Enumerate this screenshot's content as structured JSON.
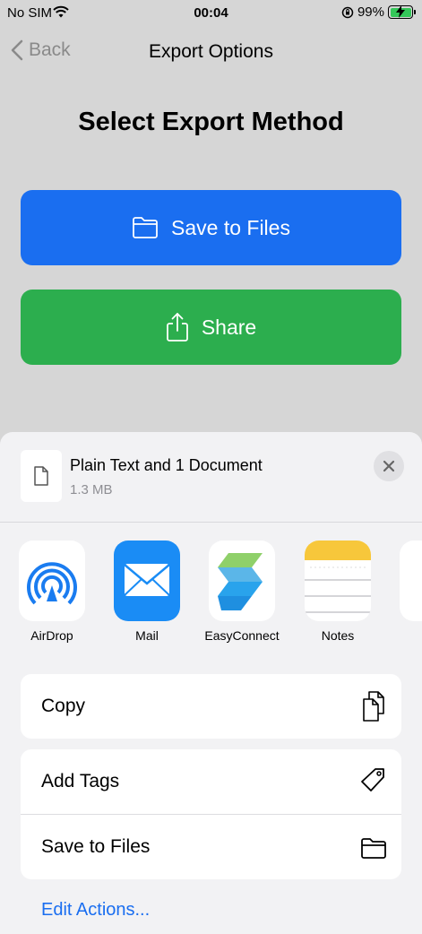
{
  "status_bar": {
    "carrier": "No SIM",
    "time": "00:04",
    "battery": "99%"
  },
  "nav": {
    "back_label": "Back",
    "title": "Export Options"
  },
  "main": {
    "heading": "Select Export Method",
    "save_button": "Save to Files",
    "share_button": "Share",
    "save_color": "#1a6ef0",
    "share_color": "#2cae4e"
  },
  "share_sheet": {
    "title": "Plain Text and 1 Document",
    "size": "1.3 MB",
    "apps": [
      {
        "label": "AirDrop",
        "icon": "airdrop-icon"
      },
      {
        "label": "Mail",
        "icon": "mail-icon"
      },
      {
        "label": "EasyConnect",
        "icon": "easyconnect-icon"
      },
      {
        "label": "Notes",
        "icon": "notes-icon"
      }
    ],
    "actions": {
      "copy": "Copy",
      "add_tags": "Add Tags",
      "save_to_files": "Save to Files"
    },
    "edit_actions": "Edit Actions..."
  }
}
